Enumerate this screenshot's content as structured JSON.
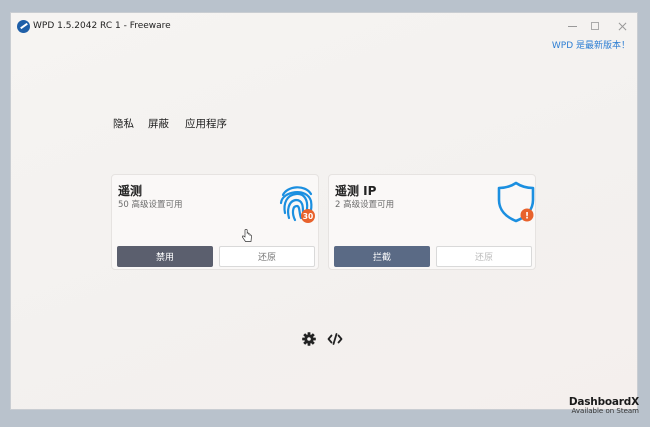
{
  "window": {
    "title": "WPD 1.5.2042 RC 1 - Freeware",
    "update_notice": "WPD 是最新版本！"
  },
  "tabs": [
    {
      "label": "隐私"
    },
    {
      "label": "屏蔽"
    },
    {
      "label": "应用程序"
    }
  ],
  "cards": [
    {
      "title": "遥测",
      "subtitle": "50 高级设置可用",
      "badge": "30",
      "primary_button": "禁用",
      "secondary_button": "还原",
      "icon": "fingerprint-icon",
      "accent": "#1b8fe0",
      "badge_color": "#e8622c"
    },
    {
      "title": "遥测 IP",
      "subtitle": "2 高级设置可用",
      "badge": "!",
      "primary_button": "拦截",
      "secondary_button": "还原",
      "icon": "shield-icon",
      "accent": "#1b8fe0",
      "badge_color": "#e8622c"
    }
  ],
  "footer": {
    "settings_icon": "gear-icon",
    "code_icon": "code-icon"
  },
  "watermark": {
    "title": "DashboardX",
    "subtitle": "Available on Steam"
  }
}
